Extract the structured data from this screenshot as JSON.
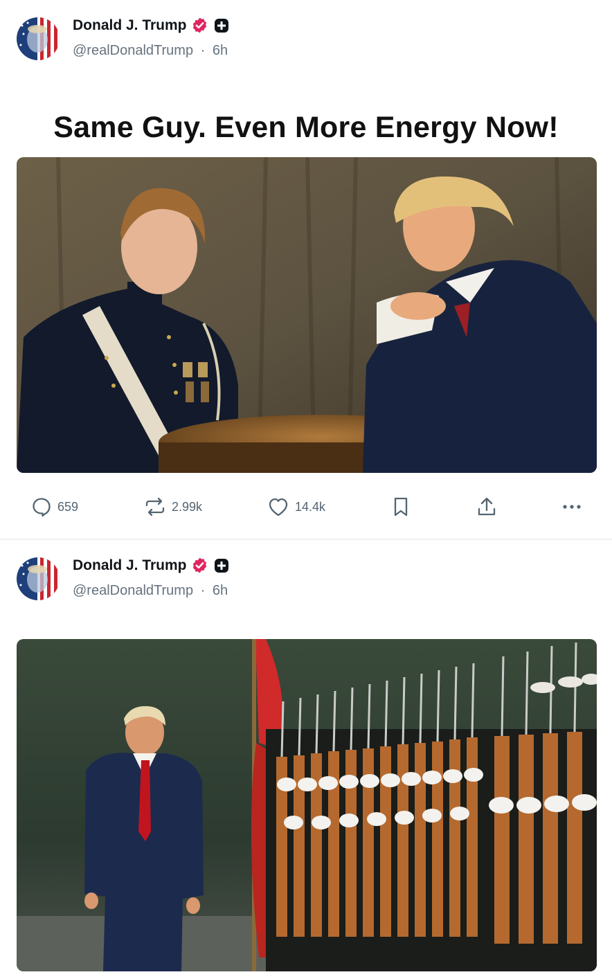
{
  "posts": [
    {
      "author": {
        "name": "Donald J. Trump",
        "handle": "@realDonaldTrump",
        "time": "6h",
        "separator": "·"
      },
      "headline": "Same Guy. Even More Energy Now!",
      "actions": {
        "reply_count": "659",
        "repost_count": "2.99k",
        "like_count": "14.4k"
      }
    },
    {
      "author": {
        "name": "Donald J. Trump",
        "handle": "@realDonaldTrump",
        "time": "6h",
        "separator": "·"
      }
    }
  ],
  "icons": {
    "reply": "speech-bubble-icon",
    "repost": "repost-arrows-icon",
    "like": "heart-icon",
    "bookmark": "bookmark-icon",
    "share": "share-upload-icon",
    "more": "more-horizontal-icon",
    "verified": "verified-badge-icon",
    "plus": "plus-badge-icon"
  },
  "colors": {
    "verified_badge": "#e0245e",
    "text_primary": "#0f1419",
    "text_secondary": "#66727e",
    "action_gray": "#536471"
  }
}
